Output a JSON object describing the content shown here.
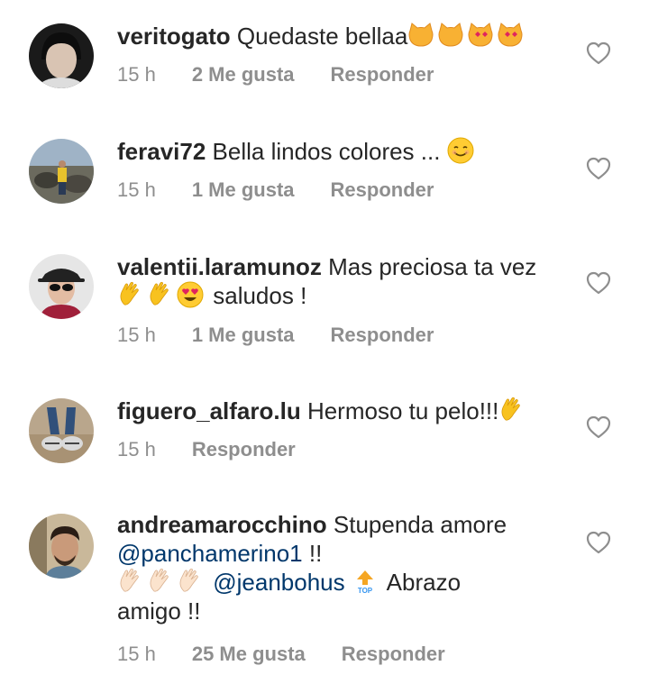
{
  "comments": [
    {
      "user": "veritogato",
      "text": "Quedaste bellaa",
      "time": "15 h",
      "likes": "2 Me gusta",
      "reply": "Responder"
    },
    {
      "user": "feravi72",
      "text": "Bella lindos colores ...",
      "time": "15 h",
      "likes": "1 Me gusta",
      "reply": "Responder"
    },
    {
      "user": "valentii.laramunoz",
      "text": "Mas preciosa ta vez",
      "text2": "saludos !",
      "time": "15 h",
      "likes": "1 Me gusta",
      "reply": "Responder"
    },
    {
      "user": "figuero_alfaro.lu",
      "text": "Hermoso tu pelo!!!",
      "time": "15 h",
      "reply": "Responder"
    },
    {
      "user": "andreamarocchino",
      "text": "Stupenda amore",
      "mention1": "@panchamerino1",
      "text_after_mention1": "!!",
      "mention2": "@jeanbohus",
      "text3": "Abrazo",
      "text4": "amigo !!",
      "time": "15 h",
      "likes": "25 Me gusta",
      "reply": "Responder"
    }
  ],
  "icons": {
    "like": "heart-outline-icon",
    "top_badge": "TOP"
  },
  "colors": {
    "text": "#262626",
    "meta": "#8e8e8e",
    "mention": "#00376b",
    "top_arrow": "#f5a623",
    "top_text": "#3897f0"
  }
}
